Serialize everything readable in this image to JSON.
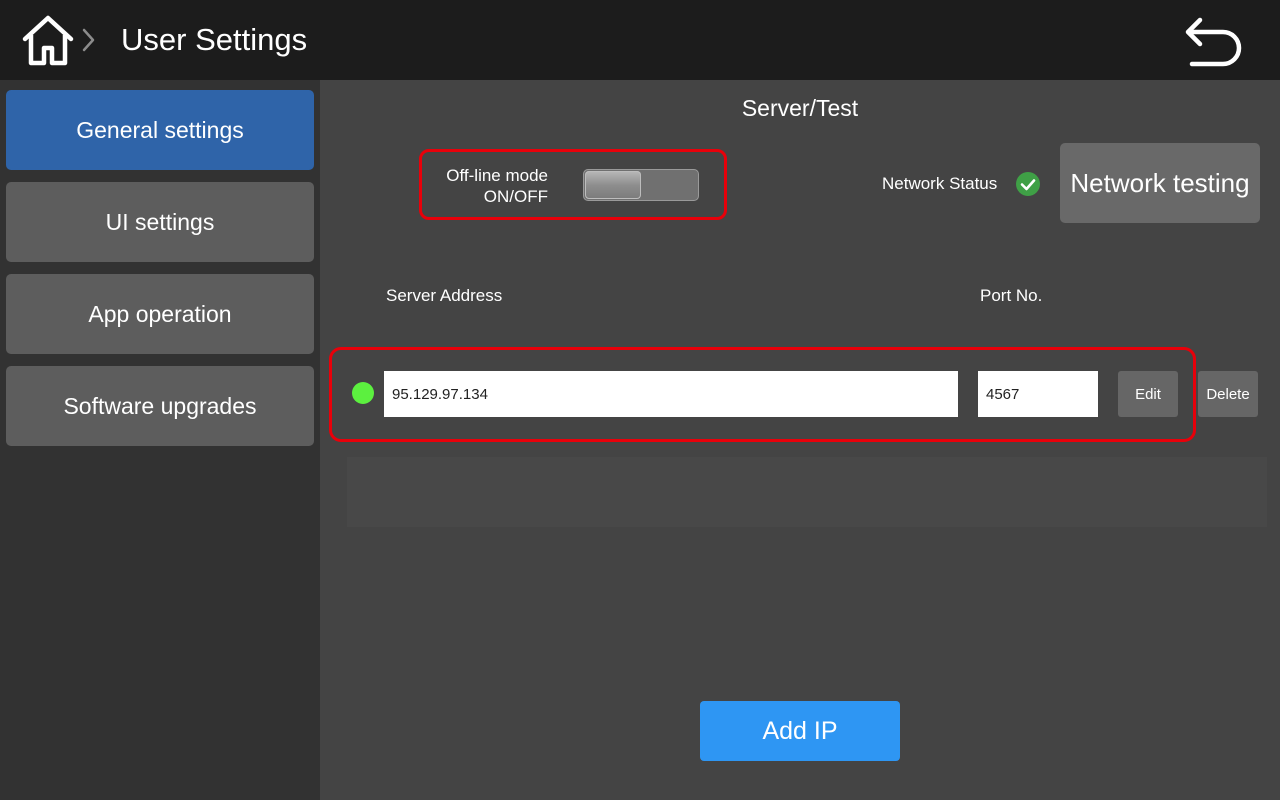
{
  "header": {
    "title": "User Settings",
    "home_icon": "home-icon",
    "breadcrumb_icon": "chevron-right-icon",
    "back_icon": "undo-arrow-icon"
  },
  "sidebar": {
    "items": [
      {
        "label": "General settings",
        "active": true
      },
      {
        "label": "UI settings",
        "active": false
      },
      {
        "label": "App operation",
        "active": false
      },
      {
        "label": "Software upgrades",
        "active": false
      }
    ]
  },
  "main": {
    "section_title": "Server/Test",
    "offline_mode": {
      "label_line1": "Off-line mode",
      "label_line2": "ON/OFF",
      "state": "OFF"
    },
    "network": {
      "status_label": "Network Status",
      "status_icon": "check-circle-icon",
      "test_button": "Network testing"
    },
    "columns": {
      "address": "Server Address",
      "port": "Port No."
    },
    "servers": [
      {
        "address": "95.129.97.134",
        "port": "4567",
        "edit_label": "Edit",
        "delete_label": "Delete"
      }
    ],
    "add_ip_label": "Add IP"
  },
  "colors": {
    "topbar": "#1c1c1c",
    "sidebar": "#323232",
    "main_bg": "#444444",
    "active_nav": "#2f64a9",
    "inactive_nav": "#5d5d5d",
    "highlight_border": "#e8000a",
    "status_ok": "#5cf03f",
    "check_green": "#3fa046",
    "add_button": "#2e96f3"
  }
}
